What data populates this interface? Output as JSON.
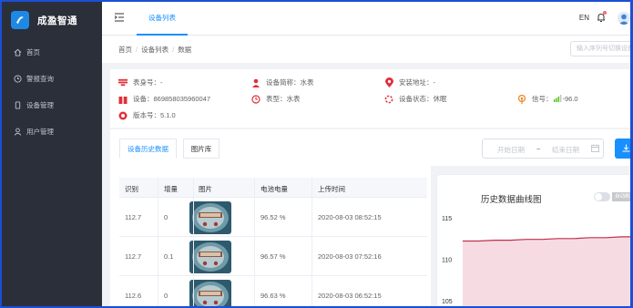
{
  "app": {
    "name": "成盈智通"
  },
  "sidebar": {
    "items": [
      {
        "label": "首页",
        "icon": "home-icon"
      },
      {
        "label": "警报查询",
        "icon": "clock-icon"
      },
      {
        "label": "设备管理",
        "icon": "device-icon"
      },
      {
        "label": "用户管理",
        "icon": "user-icon"
      }
    ]
  },
  "header": {
    "active_tab": "设备列表",
    "language": "EN"
  },
  "breadcrumb": {
    "items": [
      "首页",
      "设备列表",
      "数据"
    ]
  },
  "search": {
    "placeholder": "输入序列号切换设备"
  },
  "device": {
    "meter_no": "表身号：-",
    "short_name": "设备简称：水表",
    "install_addr": "安装地址：-",
    "device_id": "设备：869858035960047",
    "meter_type": "表型：水表",
    "status": "设备状态：休眠",
    "signal_label": "信号：",
    "signal_value": "-96.0",
    "version": "版本号：5.1.0"
  },
  "tabs": {
    "history": "设备历史数据",
    "gallery": "图片库"
  },
  "date_filter": {
    "start": "开始日期",
    "sep": "~",
    "end": "结束日期"
  },
  "table": {
    "columns": [
      "识别",
      "增量",
      "图片",
      "电池电量",
      "上传时间"
    ],
    "rows": [
      {
        "reading": "112.7",
        "increment": "0",
        "battery": "96.52 %",
        "time": "2020-08-03 08:52:15"
      },
      {
        "reading": "112.7",
        "increment": "0.1",
        "battery": "96.57 %",
        "time": "2020-08-03 07:52:16"
      },
      {
        "reading": "112.6",
        "increment": "0",
        "battery": "96.63 %",
        "time": "2020-08-03 06:52:15"
      }
    ]
  },
  "chart": {
    "title": "历史数据曲线图",
    "toggle_label": "自动刷新"
  },
  "chart_data": {
    "type": "area",
    "title": "历史数据曲线图",
    "y_ticks": [
      115,
      110,
      105
    ],
    "ylim": [
      105,
      115
    ],
    "values": [
      112.2,
      112.2,
      112.3,
      112.3,
      112.4,
      112.4,
      112.5,
      112.5,
      112.6,
      112.6,
      112.7,
      112.7
    ],
    "color": "#c0304a",
    "fill": "#f6dce2"
  },
  "colors": {
    "accent": "#1890ff",
    "sidebar": "#2b2f3a",
    "icon_red": "#e0303a",
    "icon_orange": "#f0882a",
    "signal_green": "#52c41a"
  }
}
